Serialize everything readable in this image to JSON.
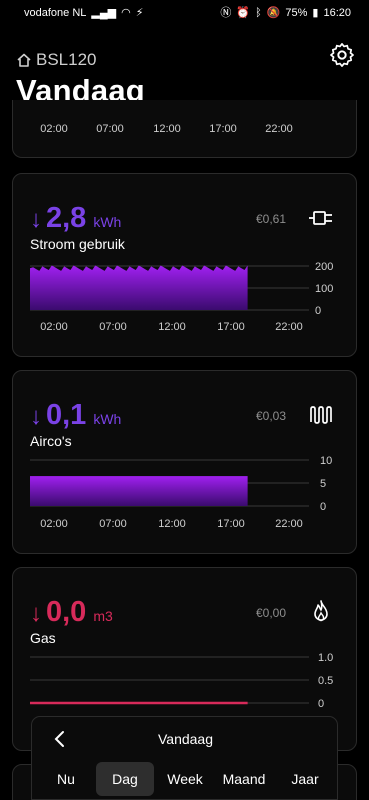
{
  "status_bar": {
    "carrier": "vodafone NL",
    "battery": "75%",
    "time": "16:20"
  },
  "header": {
    "device_name": "BSL120",
    "title": "Vandaag"
  },
  "top_card": {
    "x_ticks": [
      "02:00",
      "07:00",
      "12:00",
      "17:00",
      "22:00"
    ]
  },
  "cards": [
    {
      "id": "stroom",
      "value": "2,8",
      "unit": "kWh",
      "label": "Stroom gebruik",
      "cost": "€0,61",
      "icon": "plug-icon",
      "accent": "#7a42e6"
    },
    {
      "id": "airco",
      "value": "0,1",
      "unit": "kWh",
      "label": "Airco's",
      "cost": "€0,03",
      "icon": "heater-icon",
      "accent": "#7a42e6"
    },
    {
      "id": "gas",
      "value": "0,0",
      "unit": "m3",
      "label": "Gas",
      "cost": "€0,00",
      "icon": "flame-icon",
      "accent": "#d72a5a"
    }
  ],
  "bottom_bar": {
    "title": "Vandaag",
    "tabs": [
      "Nu",
      "Dag",
      "Week",
      "Maand",
      "Jaar"
    ],
    "active_tab": "Dag"
  },
  "chart_data": [
    {
      "type": "area",
      "series_color": "#8a1cd8",
      "x_ticks": [
        "02:00",
        "07:00",
        "12:00",
        "17:00",
        "22:00"
      ],
      "y_ticks": [
        "200",
        "100",
        "0"
      ],
      "ylim": [
        0,
        200
      ],
      "fill_ratio_of_day": 0.78,
      "approx_level": 190
    },
    {
      "type": "area",
      "series_color": "#8a1cd8",
      "x_ticks": [
        "02:00",
        "07:00",
        "12:00",
        "17:00",
        "22:00"
      ],
      "y_ticks": [
        "10",
        "5",
        "0"
      ],
      "ylim": [
        0,
        10
      ],
      "fill_ratio_of_day": 0.78,
      "approx_level": 6.5
    },
    {
      "type": "line",
      "series_color": "#d72a5a",
      "x_ticks": [],
      "y_ticks": [
        "1.0",
        "0.5",
        "0"
      ],
      "ylim": [
        0,
        1
      ],
      "fill_ratio_of_day": 0.78,
      "approx_level": 0
    }
  ]
}
